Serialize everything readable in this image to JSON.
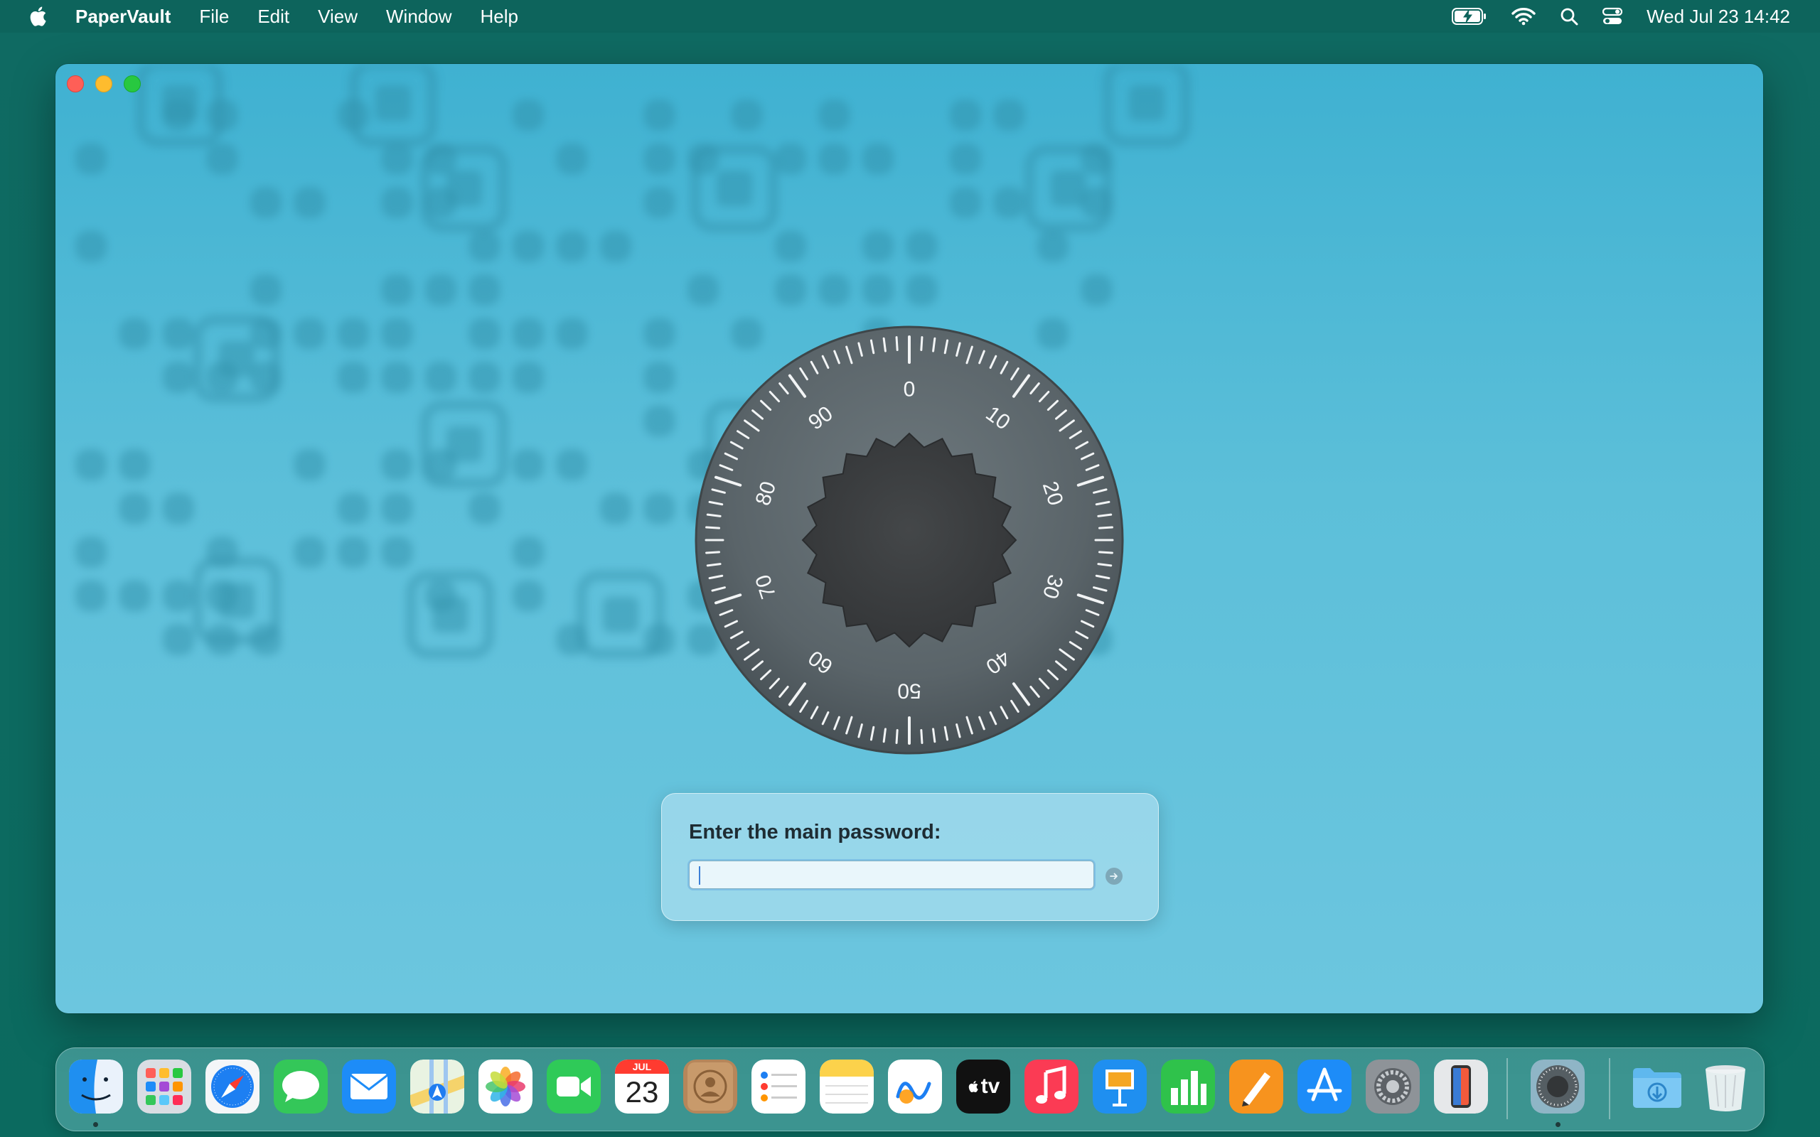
{
  "menubar": {
    "app_name": "PaperVault",
    "menus": [
      "File",
      "Edit",
      "View",
      "Window",
      "Help"
    ],
    "clock": "Wed Jul 23  14:42",
    "status_icons": [
      "battery-icon",
      "wifi-icon",
      "spotlight-search-icon",
      "control-center-icon"
    ]
  },
  "window": {
    "dial_numbers": [
      "0",
      "10",
      "20",
      "30",
      "40",
      "50",
      "60",
      "70",
      "80",
      "90"
    ],
    "password_prompt": "Enter the main password:",
    "password_value": ""
  },
  "dock": {
    "calendar_month": "JUL",
    "calendar_day": "23",
    "apple_tv_label": "tv",
    "apps": [
      "Finder",
      "Launchpad",
      "Safari",
      "Messages",
      "Mail",
      "Maps",
      "Photos",
      "FaceTime",
      "Calendar",
      "Contacts",
      "Reminders",
      "Notes",
      "Freeform",
      "Apple TV",
      "Music",
      "Keynote",
      "Numbers",
      "Pages",
      "App Store",
      "System Settings",
      "iPhone Mirroring",
      "PaperVault",
      "Downloads",
      "Trash"
    ]
  },
  "colors": {
    "desktop": "#0d6a60",
    "window_bg": "#5cbfd9",
    "dial_outer": "#5a6469",
    "dial_knob": "#3a3d3f"
  }
}
